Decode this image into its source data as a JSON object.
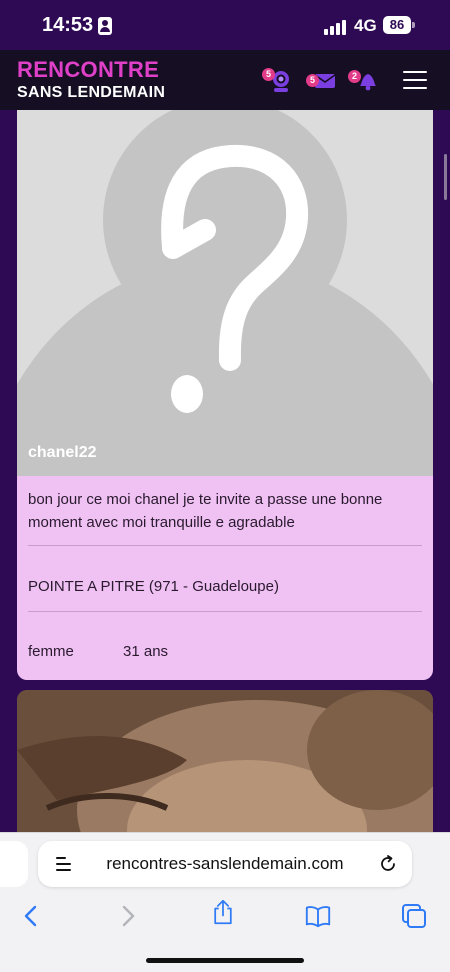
{
  "status_bar": {
    "time": "14:53",
    "network": "4G",
    "battery": "86"
  },
  "header": {
    "logo_line1": "RENCONTRE",
    "logo_line2": "SANS LENDEMAIN",
    "webcam_badge": "5",
    "messages_badge": "5",
    "notifications_badge": "2",
    "accent_color": "#e040c8",
    "badge_color": "#e23b8a"
  },
  "profile": {
    "username": "chanel22",
    "description": "bon jour ce moi chanel je te invite a passe une bonne moment avec moi tranquille e agradable",
    "location": "POINTE A PITRE (971 - Guadeloupe)",
    "gender": "femme",
    "age": "31 ans",
    "card_color": "#f0c2f4"
  },
  "browser": {
    "url": "rencontres-sanslendemain.com"
  },
  "icons": {
    "webcam": "webcam-icon",
    "messages": "envelope-icon",
    "notifications": "bell-icon",
    "menu": "hamburger-menu-icon",
    "back": "chevron-left-icon",
    "forward": "chevron-right-icon",
    "share": "share-icon",
    "bookmarks": "book-icon",
    "tabs": "tabs-icon"
  }
}
